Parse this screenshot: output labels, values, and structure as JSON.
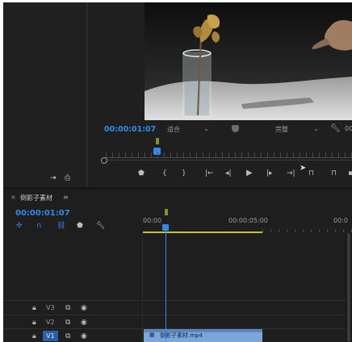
{
  "source_monitor": {
    "icons": [
      "insert-icon",
      "export-frame-icon"
    ]
  },
  "program_monitor": {
    "timecode": "00:00:01:07",
    "fit_select": "适合",
    "quality_select": "完整",
    "timecode_right": "00",
    "transport_icons": [
      "marker-icon",
      "in-point-icon",
      "out-point-icon",
      "go-to-in-icon",
      "step-back-icon",
      "play-icon",
      "step-forward-icon",
      "go-to-out-icon",
      "lift-icon",
      "extract-icon",
      "overflow-icon"
    ]
  },
  "timeline": {
    "tab_close": "×",
    "tab_title": "倒影子素材",
    "tab_menu": "≡",
    "timecode": "00:00:01:07",
    "ruler": [
      "00:00",
      "00:00:05:00",
      "00:0"
    ],
    "tracks": [
      {
        "name": "V3"
      },
      {
        "name": "V2"
      },
      {
        "name": "V1"
      }
    ],
    "clip_label": "倒影子素材.mp4",
    "colors": {
      "timecode": "#2d8ceb",
      "work_area": "#c8c328",
      "playhead": "#2d8ceb",
      "clip": "#7aa6d9"
    }
  }
}
